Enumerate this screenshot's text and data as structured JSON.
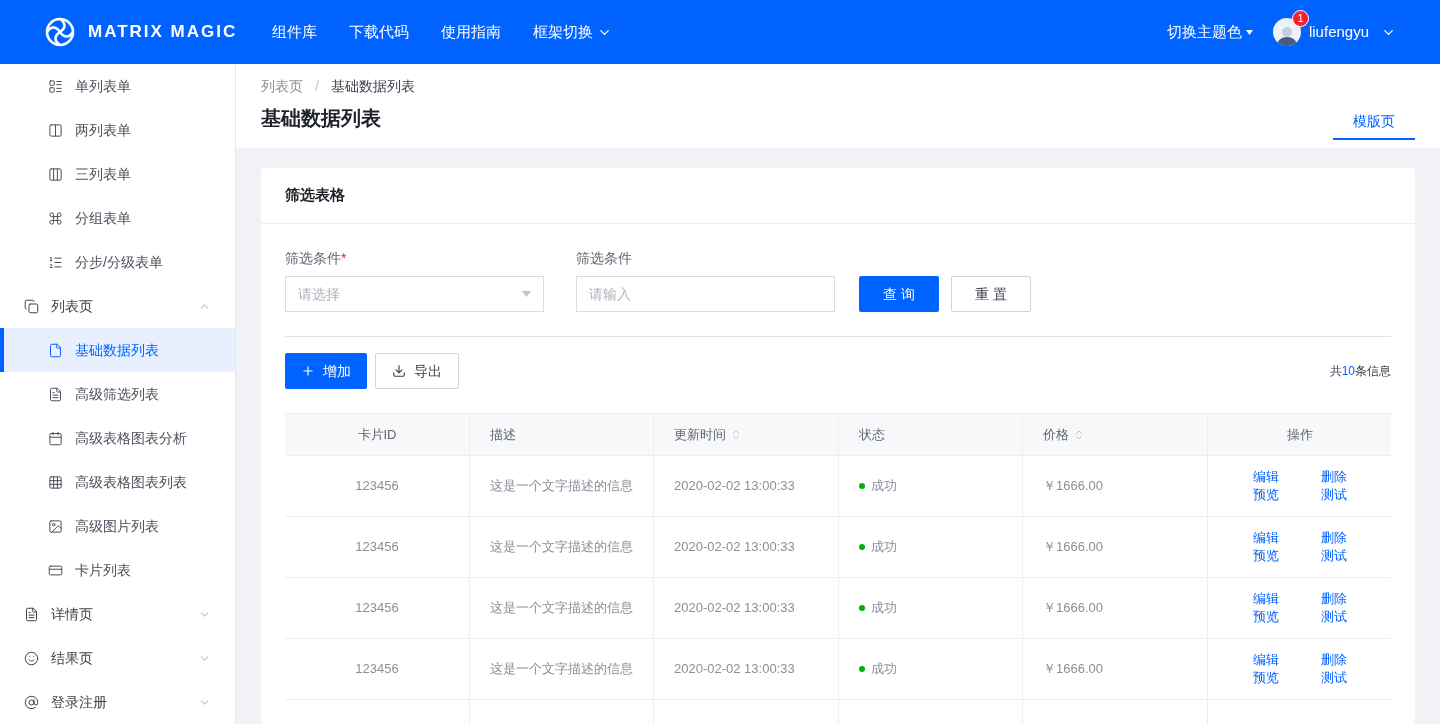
{
  "header": {
    "logo_text": "MATRIX MAGIC",
    "nav": [
      {
        "label": "组件库",
        "dropdown": false
      },
      {
        "label": "下载代码",
        "dropdown": false
      },
      {
        "label": "使用指南",
        "dropdown": false
      },
      {
        "label": "框架切换",
        "dropdown": true
      }
    ],
    "theme_switch": {
      "label": "切换主题色",
      "dropdown": true
    },
    "notification_count": "1",
    "username": "liufengyu"
  },
  "sidebar": {
    "partial_children": [
      {
        "label": "单列表单",
        "selected": false
      },
      {
        "label": "两列表单",
        "selected": false
      },
      {
        "label": "三列表单",
        "selected": false
      },
      {
        "label": "分组表单",
        "selected": false
      },
      {
        "label": "分步/分级表单",
        "selected": false
      }
    ],
    "items": [
      {
        "label": "列表页",
        "expanded": true,
        "children": [
          {
            "label": "基础数据列表",
            "selected": true
          },
          {
            "label": "高级筛选列表",
            "selected": false
          },
          {
            "label": "高级表格图表分析",
            "selected": false
          },
          {
            "label": "高级表格图表列表",
            "selected": false
          },
          {
            "label": "高级图片列表",
            "selected": false
          },
          {
            "label": "卡片列表",
            "selected": false
          }
        ]
      },
      {
        "label": "详情页",
        "expanded": false
      },
      {
        "label": "结果页",
        "expanded": false
      },
      {
        "label": "登录注册",
        "expanded": false
      }
    ]
  },
  "page_header": {
    "breadcrumb": [
      "列表页",
      "基础数据列表"
    ],
    "breadcrumb_separator": "/",
    "title": "基础数据列表",
    "tabs": [
      {
        "label": "模版页",
        "selected": true
      }
    ]
  },
  "card": {
    "title": "筛选表格",
    "required_mark": "*",
    "filters": [
      {
        "kind": "select",
        "label": "筛选条件",
        "required": true,
        "placeholder": "请选择"
      },
      {
        "kind": "input",
        "label": "筛选条件",
        "required": false,
        "placeholder": "请输入"
      }
    ],
    "filter_buttons": [
      {
        "kind": "search",
        "label": "查 询"
      },
      {
        "kind": "reset",
        "label": "重 置"
      }
    ],
    "actions": [
      {
        "kind": "add",
        "label": "增加"
      },
      {
        "kind": "export",
        "label": "导出"
      }
    ],
    "total": {
      "prefix": "共",
      "count": "10",
      "suffix": "条信息"
    },
    "table": {
      "columns": [
        {
          "label": "卡片ID",
          "sortable": false
        },
        {
          "label": "描述",
          "sortable": false
        },
        {
          "label": "更新时间",
          "sortable": true
        },
        {
          "label": "状态",
          "sortable": false
        },
        {
          "label": "价格",
          "sortable": true
        },
        {
          "label": "操作",
          "sortable": false
        }
      ],
      "rows": [
        {
          "id": "123456",
          "description": "这是一个文字描述的信息",
          "updated": "2020-02-02 13:00:33",
          "status": "成功",
          "color": "#00b300",
          "price": "￥1666.00",
          "ops": [
            "编辑",
            "删除",
            "预览",
            "测试"
          ]
        },
        {
          "id": "123456",
          "description": "这是一个文字描述的信息",
          "updated": "2020-02-02 13:00:33",
          "status": "成功",
          "color": "#00b300",
          "price": "￥1666.00",
          "ops": [
            "编辑",
            "删除",
            "预览",
            "测试"
          ]
        },
        {
          "id": "123456",
          "description": "这是一个文字描述的信息",
          "updated": "2020-02-02 13:00:33",
          "status": "成功",
          "color": "#00b300",
          "price": "￥1666.00",
          "ops": [
            "编辑",
            "删除",
            "预览",
            "测试"
          ]
        },
        {
          "id": "123456",
          "description": "这是一个文字描述的信息",
          "updated": "2020-02-02 13:00:33",
          "status": "成功",
          "color": "#00b300",
          "price": "￥1666.00",
          "ops": [
            "编辑",
            "删除",
            "预览",
            "测试"
          ]
        }
      ]
    }
  }
}
